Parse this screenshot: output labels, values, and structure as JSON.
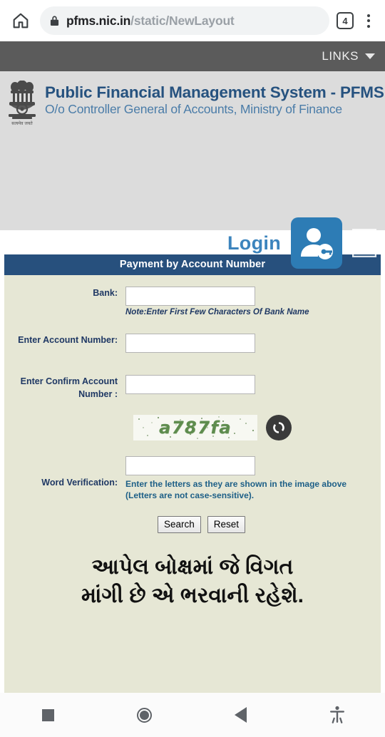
{
  "browser": {
    "home_icon": "home-icon",
    "lock_icon": "lock-icon",
    "url_host": "pfms.nic.in",
    "url_path": "/static/NewLayout",
    "tab_count": "4",
    "menu_icon": "overflow-menu-icon"
  },
  "links_bar": {
    "label": "LINKS",
    "caret_icon": "chevron-down-icon"
  },
  "site_header": {
    "emblem_icon": "india-national-emblem-icon",
    "title": "Public Financial Management System - PFMS",
    "subtitle": "O/o Controller General of Accounts, Ministry of Finance",
    "login_label": "Login",
    "login_icon": "user-key-login-icon",
    "menu_list_icon": "list-menu-icon"
  },
  "form": {
    "title": "Payment by Account Number",
    "bank": {
      "label": "Bank:",
      "value": "",
      "note": "Note:Enter First Few Characters Of Bank Name"
    },
    "account_number": {
      "label": "Enter Account Number:",
      "value": ""
    },
    "confirm_account_number": {
      "label": "Enter Confirm Account Number :",
      "value": ""
    },
    "captcha": {
      "text": "a787fa",
      "refresh_icon": "refresh-icon"
    },
    "word_verification": {
      "label": "Word Verification:",
      "value": "",
      "hint_line1": "Enter the letters as they are shown in the image above",
      "hint_line2": "(Letters are not case-sensitive)."
    },
    "buttons": {
      "search": "Search",
      "reset": "Reset"
    }
  },
  "caption": {
    "line1": "આપેલ બોક્ષમાં જે વિગત",
    "line2": "માંગી છે એ ભરવાની રહેશે."
  },
  "nav_bar": {
    "recents_icon": "recents-square-icon",
    "home_icon": "home-circle-icon",
    "back_icon": "back-triangle-icon",
    "accessibility_icon": "accessibility-icon"
  },
  "colors": {
    "title_bar": "#27507d",
    "form_bg": "#e6e7d5",
    "links_bar": "#5b5b5b",
    "header_bg": "#dcdcdc",
    "brand_title": "#26527f",
    "brand_sub": "#4a7ca8",
    "login_accent": "#2d7cb5",
    "captcha_text": "#5e8c4e",
    "hint": "#1d5f87"
  }
}
